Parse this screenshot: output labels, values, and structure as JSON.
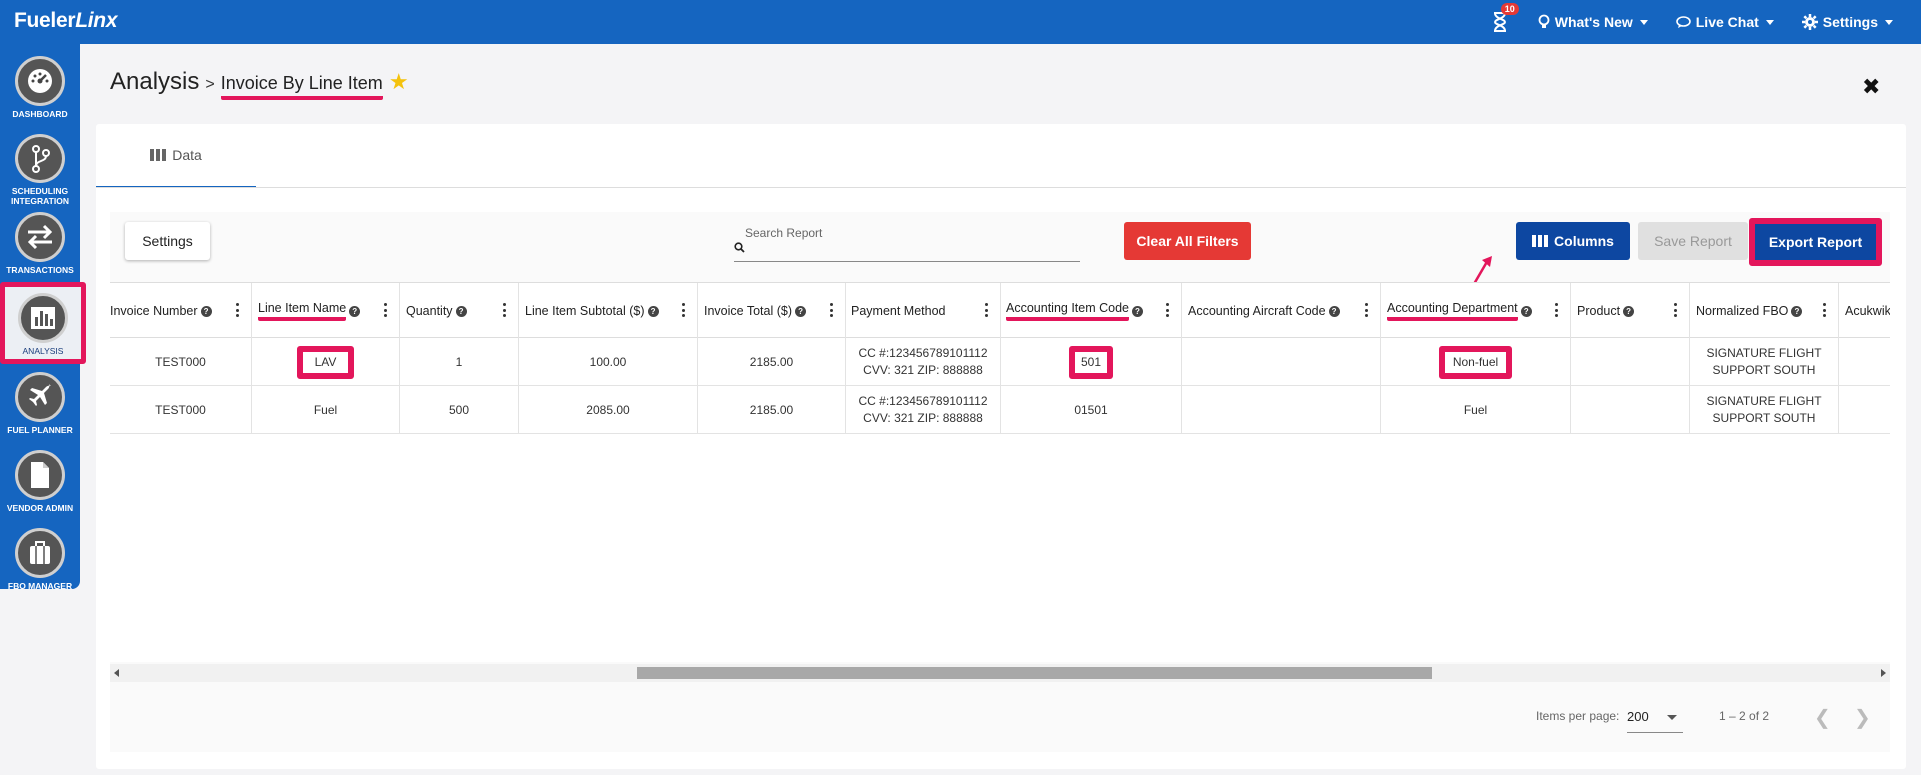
{
  "app": {
    "brand_main": "Fueler",
    "brand_italic": "Linx"
  },
  "topnav": {
    "notifications_count": "10",
    "whats_new": "What's New",
    "live_chat": "Live Chat",
    "settings": "Settings"
  },
  "sidebar": {
    "items": [
      {
        "label": "DASHBOARD",
        "icon": "dashboard-gauge-icon"
      },
      {
        "label": "SCHEDULING INTEGRATION",
        "icon": "branch-icon"
      },
      {
        "label": "TRANSACTIONS",
        "icon": "swap-arrows-icon"
      },
      {
        "label": "ANALYSIS",
        "icon": "bar-chart-icon",
        "active": true
      },
      {
        "label": "FUEL PLANNER",
        "icon": "airplane-icon"
      },
      {
        "label": "VENDOR ADMIN",
        "icon": "document-icon"
      },
      {
        "label": "FBO MANAGER",
        "icon": "briefcase-icon"
      }
    ]
  },
  "header": {
    "title": "Analysis",
    "separator": ">",
    "subtitle": "Invoice By Line Item"
  },
  "tabs": [
    {
      "label": "Data"
    }
  ],
  "toolbar": {
    "settings_label": "Settings",
    "search_placeholder": "Search Report",
    "clear_filters_label": "Clear All Filters",
    "columns_label": "Columns",
    "save_report_label": "Save Report",
    "export_report_label": "Export Report"
  },
  "table": {
    "columns": [
      "Invoice Number",
      "Line Item Name",
      "Quantity",
      "Line Item Subtotal ($)",
      "Invoice Total ($)",
      "Payment Method",
      "Accounting Item Code",
      "Accounting Aircraft Code",
      "Accounting Department",
      "Product",
      "Normalized FBO",
      "Acukwik"
    ],
    "rows": [
      {
        "invoice_number": "TEST000",
        "line_item_name": "LAV",
        "quantity": "1",
        "subtotal": "100.00",
        "invoice_total": "2185.00",
        "payment_line1": "CC #:123456789101112",
        "payment_line2": "CVV: 321 ZIP: 888888",
        "item_code": "501",
        "aircraft_code": "",
        "department": "Non-fuel",
        "product": "",
        "fbo_line1": "SIGNATURE FLIGHT",
        "fbo_line2": "SUPPORT SOUTH",
        "acukwik": ""
      },
      {
        "invoice_number": "TEST000",
        "line_item_name": "Fuel",
        "quantity": "500",
        "subtotal": "2085.00",
        "invoice_total": "2185.00",
        "payment_line1": "CC #:123456789101112",
        "payment_line2": "CVV: 321 ZIP: 888888",
        "item_code": "01501",
        "aircraft_code": "",
        "department": "Fuel",
        "product": "",
        "fbo_line1": "SIGNATURE FLIGHT",
        "fbo_line2": "SUPPORT SOUTH",
        "acukwik": ""
      }
    ]
  },
  "pagination": {
    "items_per_page_label": "Items per page:",
    "items_per_page_value": "200",
    "range": "1 – 2 of 2"
  },
  "colors": {
    "primary": "#1565c0",
    "dark_primary": "#0d47a1",
    "danger": "#e53935",
    "highlight": "#e3165b",
    "star": "#f4c20d"
  }
}
